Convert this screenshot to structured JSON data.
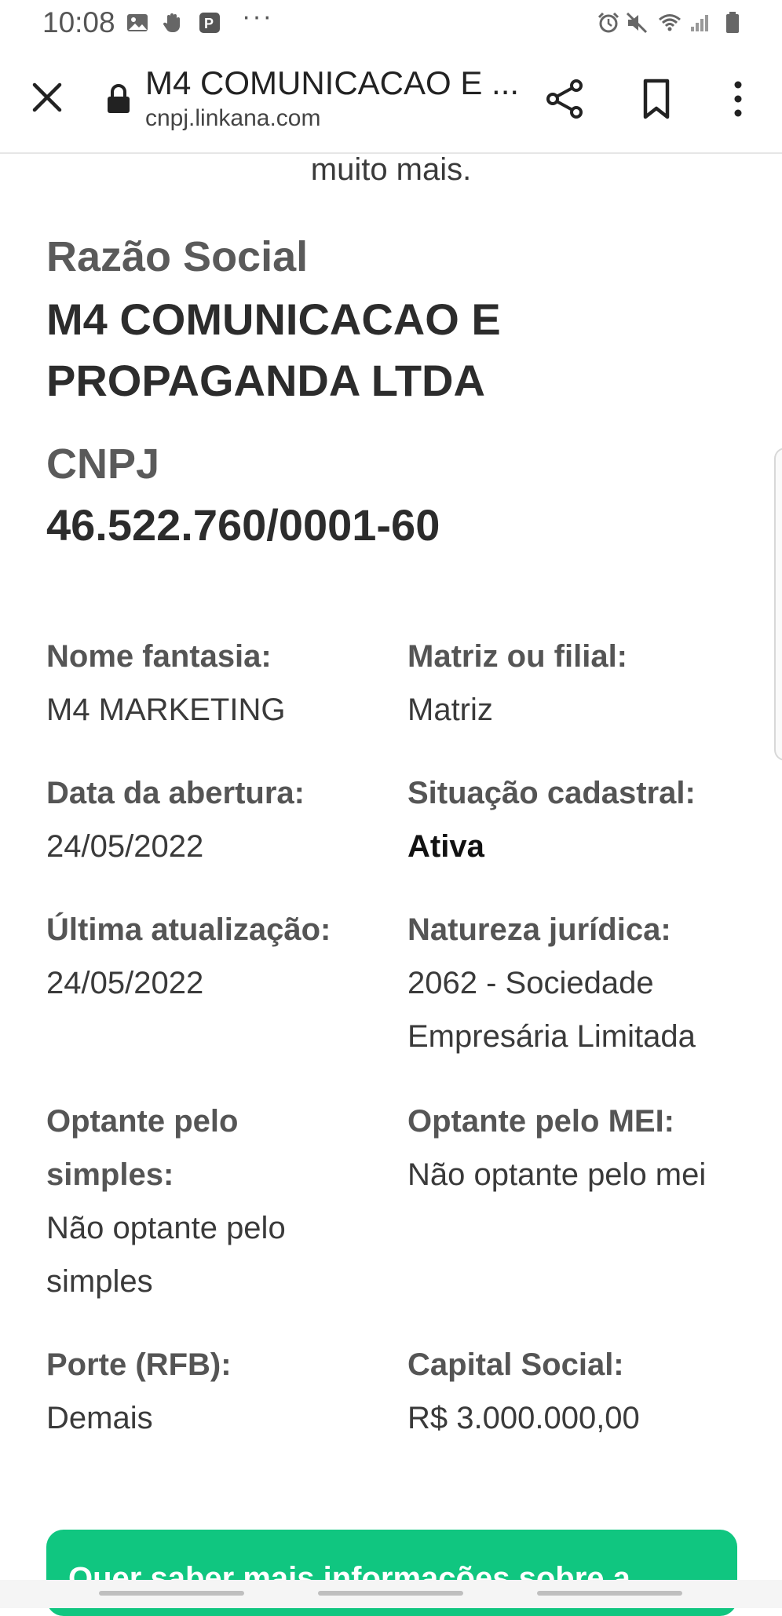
{
  "status_bar": {
    "time": "10:08",
    "dots": "···"
  },
  "toolbar": {
    "title": "M4 COMUNICACAO E ...",
    "url": "cnpj.linkana.com"
  },
  "content": {
    "top_text": "muito mais.",
    "razao_label": "Razão Social",
    "razao_line1": "M4 COMUNICACAO E",
    "razao_line2": "PROPAGANDA LTDA",
    "cnpj_label": "CNPJ",
    "cnpj_value": "46.522.760/0001-60",
    "fields": {
      "nome_fantasia": {
        "label": "Nome fantasia:",
        "value": "M4 MARKETING"
      },
      "matriz_filial": {
        "label": "Matriz ou filial:",
        "value": "Matriz"
      },
      "data_abertura": {
        "label": "Data da abertura:",
        "value": "24/05/2022"
      },
      "situacao": {
        "label": "Situação cadastral:",
        "value": "Ativa"
      },
      "ultima_atualizacao": {
        "label": "Última atualização:",
        "value": "24/05/2022"
      },
      "natureza": {
        "label": "Natureza jurídica:",
        "value_line1": "2062 - Sociedade",
        "value_line2": "Empresária Limitada"
      },
      "optante_simples": {
        "label_line1": "Optante pelo",
        "label_line2": "simples:",
        "value_line1": "Não optante pelo",
        "value_line2": "simples"
      },
      "optante_mei": {
        "label": "Optante pelo MEI:",
        "value": "Não optante pelo mei"
      },
      "porte": {
        "label": "Porte (RFB):",
        "value": "Demais"
      },
      "capital": {
        "label": "Capital Social:",
        "value": "R$ 3.000.000,00"
      }
    },
    "cta_text": "Quer saber mais informações sobre a"
  },
  "colors": {
    "accent": "#10c680",
    "text": "#2b2b2b",
    "label": "#555555"
  },
  "icons": [
    "gallery-icon",
    "hand-icon",
    "parking-app-icon",
    "alarm-icon",
    "mute-icon",
    "wifi-icon",
    "signal-icon",
    "battery-icon",
    "close-icon",
    "lock-icon",
    "share-icon",
    "bookmark-icon",
    "more-vert-icon"
  ]
}
